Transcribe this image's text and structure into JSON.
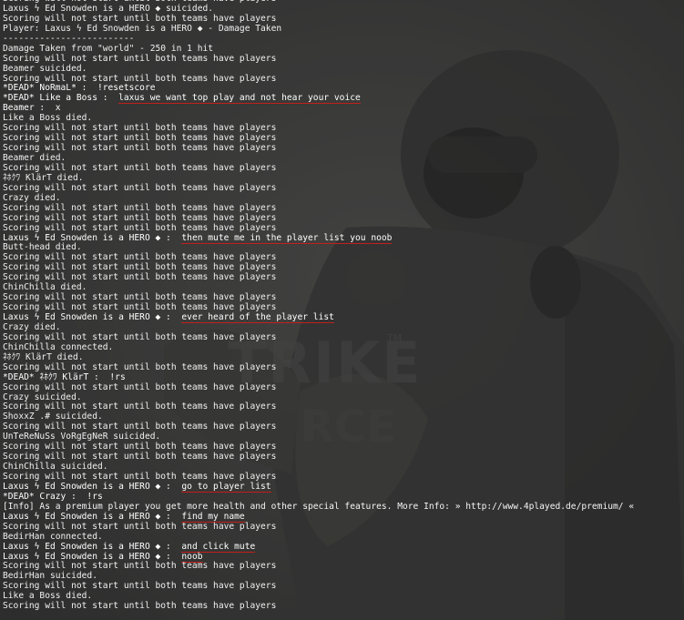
{
  "console": {
    "lines": [
      {
        "type": "system",
        "text": "Scoring will not start until both teams have players"
      },
      {
        "type": "event",
        "text": "Laxus ϟ Ed Snowden is a HERO ◆ suicided."
      },
      {
        "type": "system",
        "text": "Scoring will not start until both teams have players"
      },
      {
        "type": "event",
        "text": "Player: Laxus ϟ Ed Snowden is a HERO ◆ - Damage Taken"
      },
      {
        "type": "event",
        "text": "-------------------------"
      },
      {
        "type": "event",
        "text": "Damage Taken from \"world\" - 250 in 1 hit"
      },
      {
        "type": "system",
        "text": "Scoring will not start until both teams have players"
      },
      {
        "type": "event",
        "text": "Beamer suicided."
      },
      {
        "type": "system",
        "text": "Scoring will not start until both teams have players"
      },
      {
        "type": "chat",
        "prefix": "*DEAD* NoRmaL* :  ",
        "msg": "!resetscore",
        "highlight": false
      },
      {
        "type": "chat",
        "prefix": "*DEAD* Like a Boss :  ",
        "msg": "laxus we want top play and not hear your voice",
        "highlight": true
      },
      {
        "type": "chat",
        "prefix": "Beamer :  ",
        "msg": "x",
        "highlight": false
      },
      {
        "type": "event",
        "text": "Like a Boss died."
      },
      {
        "type": "system",
        "text": "Scoring will not start until both teams have players"
      },
      {
        "type": "system",
        "text": "Scoring will not start until both teams have players"
      },
      {
        "type": "system",
        "text": "Scoring will not start until both teams have players"
      },
      {
        "type": "event",
        "text": "Beamer died."
      },
      {
        "type": "system",
        "text": "Scoring will not start until both teams have players"
      },
      {
        "type": "event",
        "text": "ﾈﾎｸﾜ KlärT died."
      },
      {
        "type": "system",
        "text": "Scoring will not start until both teams have players"
      },
      {
        "type": "event",
        "text": "Crazy died."
      },
      {
        "type": "system",
        "text": "Scoring will not start until both teams have players"
      },
      {
        "type": "system",
        "text": "Scoring will not start until both teams have players"
      },
      {
        "type": "system",
        "text": "Scoring will not start until both teams have players"
      },
      {
        "type": "chat",
        "prefix": "Laxus ϟ Ed Snowden is a HERO ◆ :  ",
        "msg": "then mute me in the player list you noob",
        "highlight": true
      },
      {
        "type": "event",
        "text": "Butt-head died."
      },
      {
        "type": "system",
        "text": "Scoring will not start until both teams have players"
      },
      {
        "type": "system",
        "text": "Scoring will not start until both teams have players"
      },
      {
        "type": "system",
        "text": "Scoring will not start until both teams have players"
      },
      {
        "type": "event",
        "text": "ChinChilla died."
      },
      {
        "type": "system",
        "text": "Scoring will not start until both teams have players"
      },
      {
        "type": "system",
        "text": "Scoring will not start until both teams have players"
      },
      {
        "type": "chat",
        "prefix": "Laxus ϟ Ed Snowden is a HERO ◆ :  ",
        "msg": "ever heard of the player list",
        "highlight": true
      },
      {
        "type": "event",
        "text": "Crazy died."
      },
      {
        "type": "system",
        "text": "Scoring will not start until both teams have players"
      },
      {
        "type": "event",
        "text": "ChinChilla connected."
      },
      {
        "type": "event",
        "text": "ﾈﾎｸﾜ KlärT died."
      },
      {
        "type": "system",
        "text": "Scoring will not start until both teams have players"
      },
      {
        "type": "chat",
        "prefix": "*DEAD* ﾈﾎｸﾜ KlärT :  ",
        "msg": "!rs",
        "highlight": false
      },
      {
        "type": "system",
        "text": "Scoring will not start until both teams have players"
      },
      {
        "type": "event",
        "text": "Crazy suicided."
      },
      {
        "type": "system",
        "text": "Scoring will not start until both teams have players"
      },
      {
        "type": "event",
        "text": "ShoxxZ .# suicided."
      },
      {
        "type": "system",
        "text": "Scoring will not start until both teams have players"
      },
      {
        "type": "event",
        "text": "UnTeReNuSs VoRgEgNeR suicided."
      },
      {
        "type": "system",
        "text": "Scoring will not start until both teams have players"
      },
      {
        "type": "system",
        "text": "Scoring will not start until both teams have players"
      },
      {
        "type": "event",
        "text": "ChinChilla suicided."
      },
      {
        "type": "system",
        "text": "Scoring will not start until both teams have players"
      },
      {
        "type": "chat",
        "prefix": "Laxus ϟ Ed Snowden is a HERO ◆ :  ",
        "msg": "go to player list",
        "highlight": true
      },
      {
        "type": "chat",
        "prefix": "*DEAD* Crazy :  ",
        "msg": "!rs",
        "highlight": false
      },
      {
        "type": "info",
        "text": "[Info] As a premium player you get more health and other special features. More Info: » http://www.4played.de/premium/ «"
      },
      {
        "type": "chat",
        "prefix": "Laxus ϟ Ed Snowden is a HERO ◆ :  ",
        "msg": "find my name",
        "highlight": true
      },
      {
        "type": "system",
        "text": "Scoring will not start until both teams have players"
      },
      {
        "type": "event",
        "text": "BedirHan connected."
      },
      {
        "type": "chat",
        "prefix": "Laxus ϟ Ed Snowden is a HERO ◆ :  ",
        "msg": "and click mute",
        "highlight": true
      },
      {
        "type": "chat",
        "prefix": "Laxus ϟ Ed Snowden is a HERO ◆ :  ",
        "msg": "noob",
        "highlight": true
      },
      {
        "type": "system",
        "text": "Scoring will not start until both teams have players"
      },
      {
        "type": "event",
        "text": "BedirHan suicided."
      },
      {
        "type": "system",
        "text": "Scoring will not start until both teams have players"
      },
      {
        "type": "event",
        "text": "Like a Boss died."
      },
      {
        "type": "system",
        "text": "Scoring will not start until both teams have players"
      }
    ]
  },
  "background": {
    "logo_text": "TRIKE",
    "logo_sub_text": "RCE",
    "trademark": "TM",
    "colors": {
      "base": "#383838",
      "logo": "#4a4a4a",
      "text": "#f0f0f0",
      "underline": "#c0201c"
    }
  }
}
